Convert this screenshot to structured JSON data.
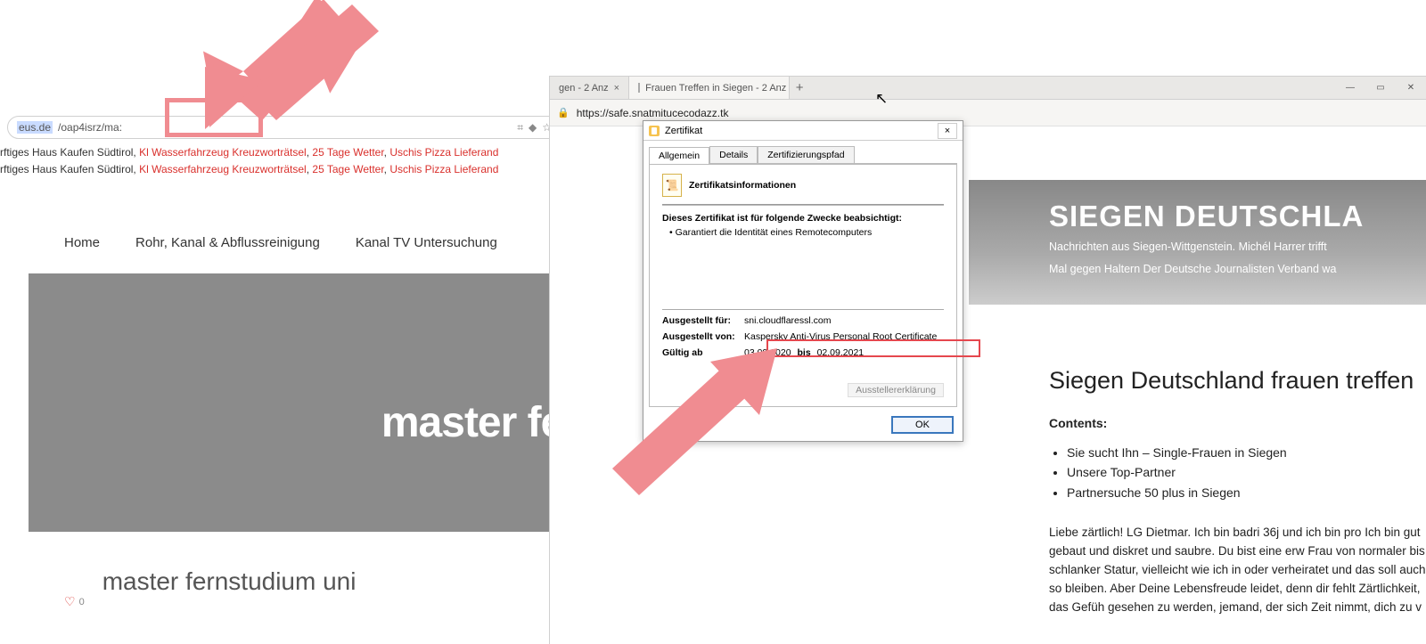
{
  "left": {
    "url_prefix": "eus.de",
    "url_path": "/oap4isrz/ma:",
    "urlbar_icons": {
      "qr": "⌗",
      "favicon": "◆",
      "star": "☆"
    },
    "links_line": {
      "prefix": "rftiges Haus Kaufen Südtirol",
      "a1": "Kl Wasserfahrzeug Kreuzworträtsel",
      "a2": "25 Tage Wetter",
      "a3": "Uschis Pizza Lieferand"
    },
    "nav": {
      "home": "Home",
      "n2": "Rohr, Kanal & Abflussreinigung",
      "n3": "Kanal TV Untersuchung"
    },
    "hero_text": "master fer",
    "post_title": "master fernstudium uni",
    "likes": {
      "icon": "♡",
      "count": "0"
    }
  },
  "right": {
    "tabs": {
      "t1": "gen - 2 Anz",
      "t2": "Frauen Treffen in Siegen - 2 Anz",
      "close": "×",
      "plus": "+"
    },
    "win": {
      "min": "—",
      "max": "▭",
      "close": "✕"
    },
    "lock": "🔒",
    "url": "https://safe.snatmitucecodazz.tk",
    "cursor": "↖",
    "banner": {
      "title": "SIEGEN DEUTSCHLA",
      "sub1": "Nachrichten aus Siegen-Wittgenstein. Michél Harrer trifft",
      "sub2": "Mal gegen Haltern Der Deutsche Journalisten Verband wa"
    },
    "article": {
      "heading": "Siegen Deutschland frauen treffen",
      "contents": "Contents:",
      "li1": "Sie sucht Ihn – Single-Frauen in Siegen",
      "li2": "Unsere Top-Partner",
      "li3": "Partnersuche 50 plus in Siegen",
      "body": "Liebe zärtlich! LG Dietmar. Ich bin badri 36j und ich bin pro Ich bin gut gebaut und diskret und saubre. Du bist eine erw Frau von normaler bis schlanker Statur, vielleicht wie ich in oder verheiratet und das soll auch so bleiben. Aber Deine Lebensfreude leidet, denn dir fehlt Zärtlichkeit, das Gefüh gesehen zu werden, jemand, der sich Zeit nimmt, dich zu v"
    }
  },
  "cert": {
    "title": "Zertifikat",
    "tabs": {
      "t1": "Allgemein",
      "t2": "Details",
      "t3": "Zertifizierungspfad"
    },
    "info": "Zertifikatsinformationen",
    "purpose": "Dieses Zertifikat ist für folgende Zwecke beabsichtigt:",
    "bullet": "• Garantiert die Identität eines Remotecomputers",
    "issued_for_lab": "Ausgestellt für:",
    "issued_for_val": "sni.cloudflaressl.com",
    "issued_by_lab": "Ausgestellt von:",
    "issued_by_val": "Kaspersky Anti-Virus Personal Root Certificate",
    "valid_lab": "Gültig ab",
    "valid_from": "03.09.2020",
    "valid_sep": "bis",
    "valid_to": "02.09.2021",
    "issuer_btn": "Ausstellererklärung",
    "ok": "OK",
    "close": "×"
  }
}
